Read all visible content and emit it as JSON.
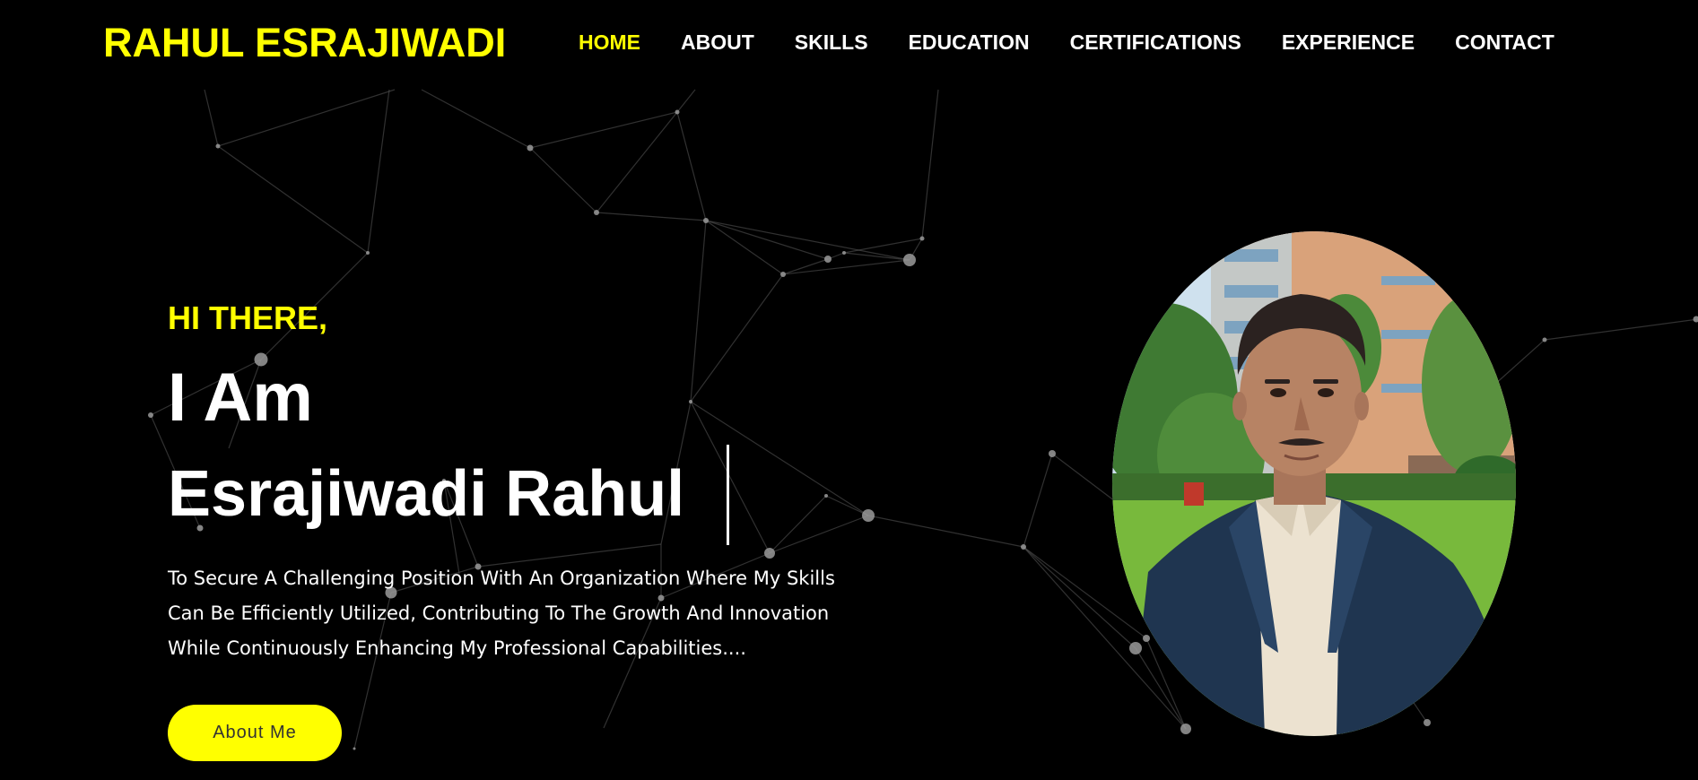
{
  "header": {
    "logo": "RAHUL ESRAJIWADI",
    "nav": [
      {
        "label": "HOME",
        "active": true
      },
      {
        "label": "ABOUT",
        "active": false
      },
      {
        "label": "SKILLS",
        "active": false
      },
      {
        "label": "EDUCATION",
        "active": false
      },
      {
        "label": "CERTIFICATIONS",
        "active": false
      },
      {
        "label": "EXPERIENCE",
        "active": false
      },
      {
        "label": "CONTACT",
        "active": false
      }
    ]
  },
  "hero": {
    "greeting": "HI THERE,",
    "heading_line1": "I Am",
    "heading_line2": "Esrajiwadi Rahul",
    "tagline_lines": [
      "To Secure A Challenging Position With An Organization Where My Skills",
      "Can Be Efficiently Utilized, Contributing To The Growth And Innovation",
      "While Continuously Enhancing My Professional Capabilities...."
    ],
    "cta_label": "About Me"
  },
  "colors": {
    "accent": "#ffff00",
    "background": "#000000",
    "text": "#ffffff"
  },
  "icons": {
    "background": "particle-network-background",
    "photo": "profile-photo"
  }
}
